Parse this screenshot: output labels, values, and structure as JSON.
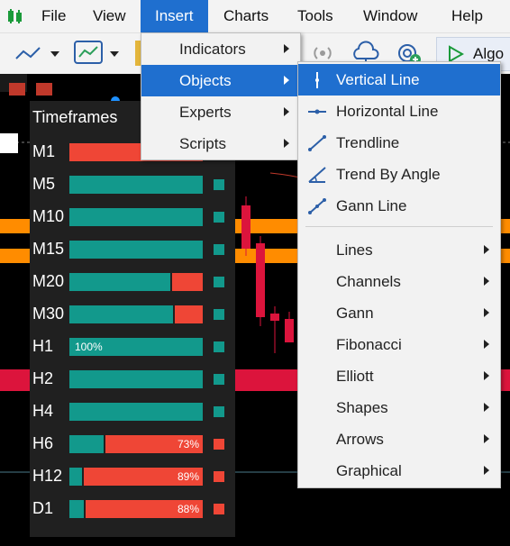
{
  "menubar": {
    "items": [
      {
        "label": "File"
      },
      {
        "label": "View"
      },
      {
        "label": "Insert"
      },
      {
        "label": "Charts"
      },
      {
        "label": "Tools"
      },
      {
        "label": "Window"
      },
      {
        "label": "Help"
      }
    ]
  },
  "toolbar": {
    "algo_label": "Algo"
  },
  "timeframes": {
    "title": "Timeframes",
    "rows": [
      {
        "label": "M1",
        "green": 0.0,
        "red": 1.0,
        "pct": "",
        "square": "#ef4636"
      },
      {
        "label": "M5",
        "green": 1.0,
        "red": 0.0,
        "pct": "",
        "square": "#12998c"
      },
      {
        "label": "M10",
        "green": 1.0,
        "red": 0.0,
        "pct": "",
        "square": "#12998c"
      },
      {
        "label": "M15",
        "green": 1.0,
        "red": 0.0,
        "pct": "",
        "square": "#12998c"
      },
      {
        "label": "M20",
        "green": 0.77,
        "red": 0.23,
        "pct": "",
        "square": "#12998c"
      },
      {
        "label": "M30",
        "green": 0.79,
        "red": 0.21,
        "pct": "",
        "square": "#12998c"
      },
      {
        "label": "H1",
        "green": 1.0,
        "red": 0.0,
        "pct": "100%",
        "square": "#12998c"
      },
      {
        "label": "H2",
        "green": 1.0,
        "red": 0.0,
        "pct": "",
        "square": "#12998c"
      },
      {
        "label": "H4",
        "green": 1.0,
        "red": 0.0,
        "pct": "",
        "square": "#12998c"
      },
      {
        "label": "H6",
        "green": 0.27,
        "red": 0.73,
        "pct": "73%",
        "square": "#ef4636"
      },
      {
        "label": "H12",
        "green": 0.11,
        "red": 0.89,
        "pct": "89%",
        "square": "#ef4636"
      },
      {
        "label": "D1",
        "green": 0.12,
        "red": 0.88,
        "pct": "88%",
        "square": "#ef4636"
      }
    ]
  },
  "insert_menu": {
    "items": [
      {
        "label": "Indicators",
        "submenu": true
      },
      {
        "label": "Objects",
        "submenu": true,
        "selected": true
      },
      {
        "label": "Experts",
        "submenu": true
      },
      {
        "label": "Scripts",
        "submenu": true
      }
    ]
  },
  "objects_menu": {
    "items": [
      {
        "label": "Vertical Line",
        "icon": "vertical-line-icon",
        "selected": true
      },
      {
        "label": "Horizontal Line",
        "icon": "horizontal-line-icon"
      },
      {
        "label": "Trendline",
        "icon": "trendline-icon"
      },
      {
        "label": "Trend By Angle",
        "icon": "trend-by-angle-icon"
      },
      {
        "label": "Gann Line",
        "icon": "gann-line-icon"
      },
      {
        "label": "Lines",
        "submenu": true
      },
      {
        "label": "Channels",
        "submenu": true
      },
      {
        "label": "Gann",
        "submenu": true
      },
      {
        "label": "Fibonacci",
        "submenu": true
      },
      {
        "label": "Elliott",
        "submenu": true
      },
      {
        "label": "Shapes",
        "submenu": true
      },
      {
        "label": "Arrows",
        "submenu": true
      },
      {
        "label": "Graphical",
        "submenu": true
      }
    ]
  },
  "colors": {
    "accent": "#1f6fcf",
    "bull": "#12998c",
    "bear": "#ef4636",
    "level_band": "#ff8c00",
    "red_band": "#dc143c"
  }
}
